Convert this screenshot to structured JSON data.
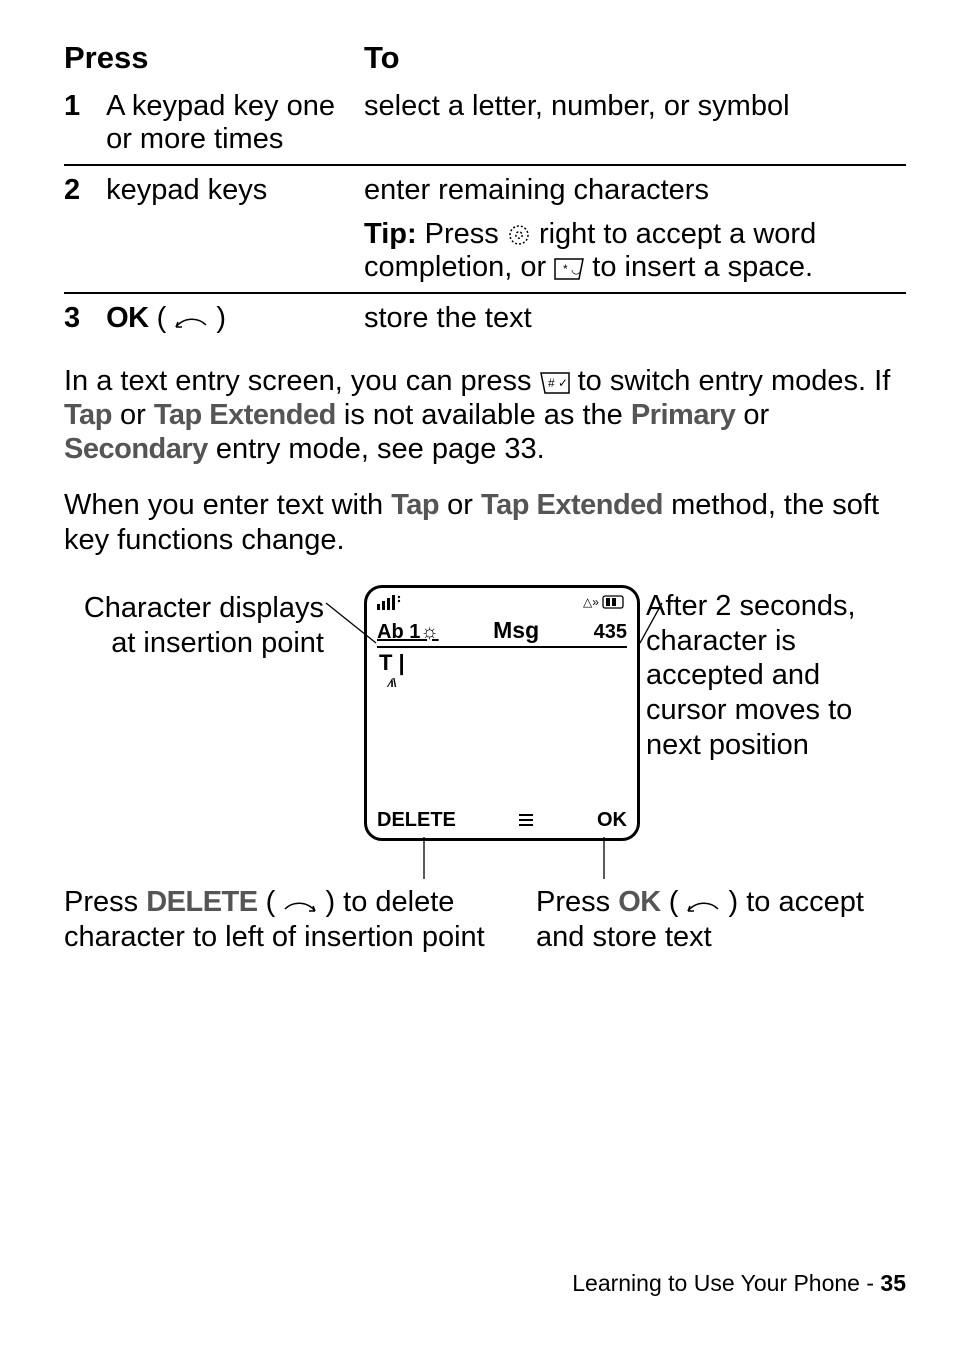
{
  "table": {
    "headers": {
      "press": "Press",
      "to": "To"
    },
    "rows": [
      {
        "num": "1",
        "press": "A keypad key one or more times",
        "to": "select a letter, number, or symbol"
      },
      {
        "num": "2",
        "press": "keypad keys",
        "to": "enter remaining characters",
        "tip_label": "Tip:",
        "tip_before_icon1": " Press ",
        "tip_between": " right to accept a word completion, or ",
        "tip_after": " to insert a space."
      },
      {
        "num": "3",
        "press_label": "OK",
        "to": "store the text"
      }
    ]
  },
  "para1": {
    "a": "In a text entry screen, you can press ",
    "b": " to switch entry modes. If ",
    "tap": "Tap",
    "or1": " or ",
    "tapext": "Tap Extended",
    "c": " is not available as the ",
    "primary": "Primary",
    "or2": " or ",
    "secondary": "Secondary",
    "d": " entry mode, see page 33."
  },
  "para2": {
    "a": "When you enter text with ",
    "tap": "Tap",
    "or": " or ",
    "tapext": "Tap Extended",
    "b": " method, the soft key functions change."
  },
  "illus": {
    "left": "Character displays at insertion point",
    "right": "After 2 seconds, character is accepted and cursor moves to next position",
    "phone": {
      "signal": "▮▮▯▯▯",
      "batt": "▯▯▯",
      "mode": "Ab 1☼",
      "title": "Msg",
      "count": "435",
      "entered": "T |",
      "caret": "⁄ ı \\",
      "soft_left": "DELETE",
      "soft_right": "OK"
    },
    "cap_left_a": "Press ",
    "cap_left_del": "DELETE",
    "cap_left_b": " (",
    "cap_left_c": " ) to delete character to left of insertion point",
    "cap_right_a": "Press ",
    "cap_right_ok": "OK",
    "cap_right_b": " (",
    "cap_right_c": ") to accept and store text"
  },
  "footer": {
    "label": "Learning to Use Your Phone - ",
    "page": "35"
  }
}
